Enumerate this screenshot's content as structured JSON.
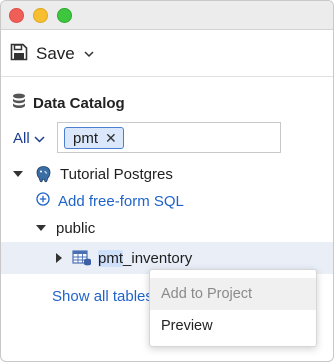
{
  "toolbar": {
    "save_label": "Save"
  },
  "catalog": {
    "title": "Data Catalog"
  },
  "filter": {
    "scope_label": "All",
    "chip_label": "pmt"
  },
  "tree": {
    "connection": "Tutorial Postgres",
    "add_sql": "Add free-form SQL",
    "schema": "public",
    "table_match": "pmt",
    "table_rest": "_inventory",
    "show_all": "Show all tables"
  },
  "context_menu": {
    "items": [
      {
        "label": "Add to Project",
        "enabled": false
      },
      {
        "label": "Preview",
        "enabled": true
      }
    ]
  },
  "colors": {
    "accent": "#1f63c9",
    "chip_bg": "#dbe8fb",
    "chip_border": "#4b7fd1",
    "selected_row": "#e9eef7"
  }
}
